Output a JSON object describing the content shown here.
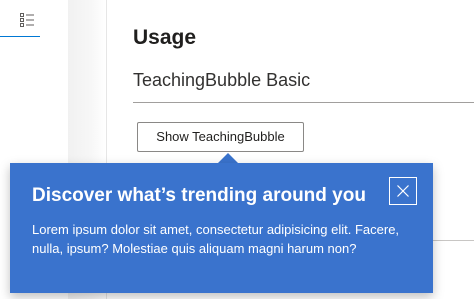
{
  "nav": {
    "icon": "bulleted-list-icon"
  },
  "content": {
    "section_title": "Usage",
    "example_title": "TeachingBubble Basic",
    "show_button_label": "Show TeachingBubble"
  },
  "teaching_bubble": {
    "headline": "Discover what’s trending around you",
    "body": "Lorem ipsum dolor sit amet, consectetur adipisicing elit. Facere, nulla, ipsum? Molestiae quis aliquam magni harum non?",
    "close_icon": "close-icon",
    "background_color": "#3a73cd"
  },
  "colors": {
    "accent": "#0078d4",
    "text": "#201f1e"
  }
}
